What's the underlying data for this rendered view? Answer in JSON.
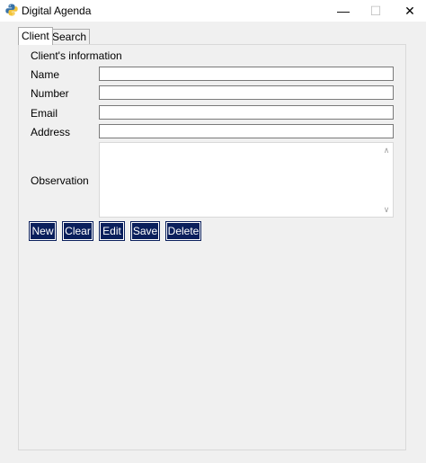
{
  "window": {
    "title": "Digital Agenda",
    "minimize_glyph": "—",
    "maximize_glyph": "☐",
    "close_glyph": "✕"
  },
  "tabs": [
    {
      "label": "Client",
      "active": true
    },
    {
      "label": "Search",
      "active": false
    }
  ],
  "form": {
    "section_title": "Client's information",
    "fields": {
      "name": {
        "label": "Name",
        "value": ""
      },
      "number": {
        "label": "Number",
        "value": ""
      },
      "email": {
        "label": "Email",
        "value": ""
      },
      "address": {
        "label": "Address",
        "value": ""
      },
      "observation": {
        "label": "Observation",
        "value": ""
      }
    }
  },
  "buttons": {
    "new": "New",
    "clear": "Clear",
    "edit": "Edit",
    "save": "Save",
    "delete": "Delete"
  },
  "colors": {
    "button_bg": "#0a1f5c",
    "button_text": "#ffffff",
    "window_bg": "#f0f0f0"
  },
  "icons": {
    "app": "python-icon",
    "scroll_up": "scroll-up-arrow-icon",
    "scroll_down": "scroll-down-arrow-icon"
  }
}
